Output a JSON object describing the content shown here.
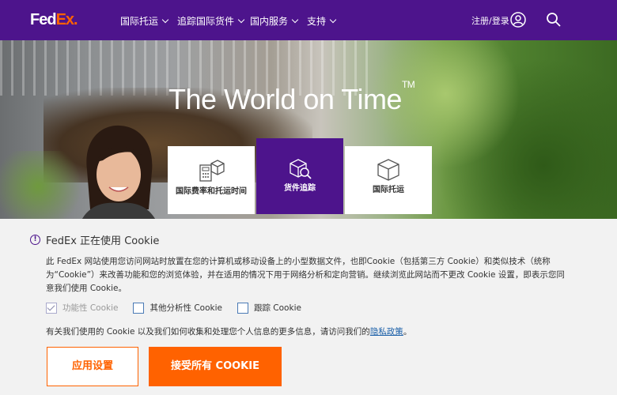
{
  "header": {
    "logo": {
      "part1": "Fed",
      "part2": "Ex",
      "suffix": "."
    },
    "nav": [
      {
        "label": "国际托运"
      },
      {
        "label": "追踪国际货件"
      },
      {
        "label": "国内服务"
      },
      {
        "label": "支持"
      }
    ],
    "login_label": "注册/登录",
    "icons": {
      "user": "user-icon",
      "search": "search-icon"
    }
  },
  "hero": {
    "title": "The World on Time",
    "trademark": "TM",
    "tiles": [
      {
        "label": "国际费率和托运时间",
        "icon": "rates-calculator-icon",
        "active": false
      },
      {
        "label": "货件追踪",
        "icon": "package-search-icon",
        "active": true
      },
      {
        "label": "国际托运",
        "icon": "package-icon",
        "active": false
      }
    ]
  },
  "cookie_banner": {
    "title": "FedEx 正在使用 Cookie",
    "body": "此 FedEx 网站使用您访问网站时放置在您的计算机或移动设备上的小型数据文件，也即Cookie（包括第三方 Cookie）和类似技术（统称为“Cookie”）来改善功能和您的浏览体验，并在适用的情况下用于网络分析和定向营销。继续浏览此网站而不更改 Cookie 设置，即表示您同意我们使用 Cookie。",
    "checkboxes": [
      {
        "label": "功能性 Cookie",
        "checked": true,
        "disabled": true
      },
      {
        "label": "其他分析性 Cookie",
        "checked": false,
        "disabled": false
      },
      {
        "label": "跟踪 Cookie",
        "checked": false,
        "disabled": false
      }
    ],
    "privacy_text": "有关我们使用的 Cookie 以及我们如何收集和处理您个人信息的更多信息，请访问我们的",
    "privacy_link": "隐私政策",
    "privacy_end": "。",
    "settings_button": "应用设置",
    "accept_button": "接受所有 COOKIE"
  },
  "colors": {
    "brand_purple": "#4d148c",
    "brand_orange": "#ff6200",
    "link": "#1a5fa8"
  }
}
